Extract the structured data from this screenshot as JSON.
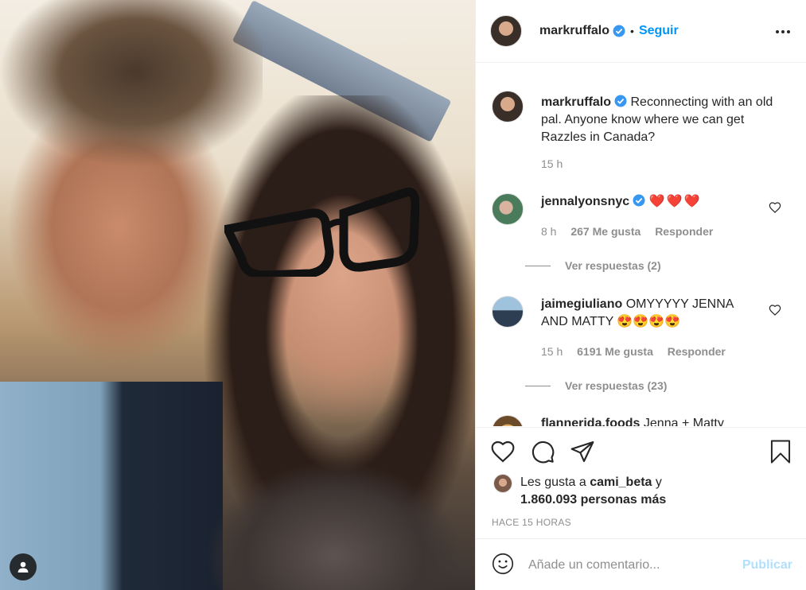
{
  "post": {
    "username": "markruffalo",
    "follow_label": "Seguir",
    "separator": "•"
  },
  "caption": {
    "username": "markruffalo",
    "text": "Reconnecting with an old pal. Anyone know where we can get Razzles in Canada?",
    "time": "15 h"
  },
  "comments": [
    {
      "username": "jennalyonsnyc",
      "text": "❤️❤️❤️",
      "time": "8 h",
      "likes": "267 Me gusta",
      "reply": "Responder",
      "view_replies": "Ver respuestas (2)"
    },
    {
      "username": "jaimegiuliano",
      "text": "OMYYYYY JENNA AND MATTY 😍😍😍😍",
      "time": "15 h",
      "likes": "6191 Me gusta",
      "reply": "Responder",
      "view_replies": "Ver respuestas (23)"
    },
    {
      "username": "flannerida.foods",
      "text": "Jenna + Matty"
    }
  ],
  "likes": {
    "prefix": "Les gusta a",
    "user": "cami_beta",
    "joiner": "y",
    "count": "1.860.093 personas más"
  },
  "time_ago": "HACE 15 HORAS",
  "comment_box": {
    "placeholder": "Añade un comentario...",
    "publish_label": "Publicar"
  },
  "colors": {
    "accent": "#0095f6",
    "publish_disabled": "#b2dffc",
    "verified": "#3897f0",
    "heart_red": "#ed4956"
  },
  "icons": [
    "user-tag-icon",
    "verified-icon",
    "more-icon",
    "heart-icon",
    "comment-icon",
    "share-icon",
    "bookmark-icon",
    "emoji-icon"
  ]
}
